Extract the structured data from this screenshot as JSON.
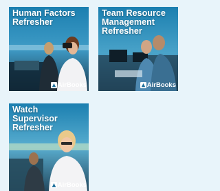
{
  "cards": [
    {
      "title": "Human Factors\nRefresher",
      "brand": "AirBooks",
      "logo_icon": "airbooks-logo-icon"
    },
    {
      "title": "Team Resource\nManagement\nRefresher",
      "brand": "AirBooks",
      "logo_icon": "airbooks-logo-icon"
    },
    {
      "title": "Watch\nSupervisor\nRefresher",
      "brand": "AirBooks",
      "logo_icon": "airbooks-logo-icon"
    }
  ],
  "colors": {
    "page_bg": "#e8f4fa",
    "card_overlay": "#1d6f9c",
    "text": "#ffffff"
  }
}
